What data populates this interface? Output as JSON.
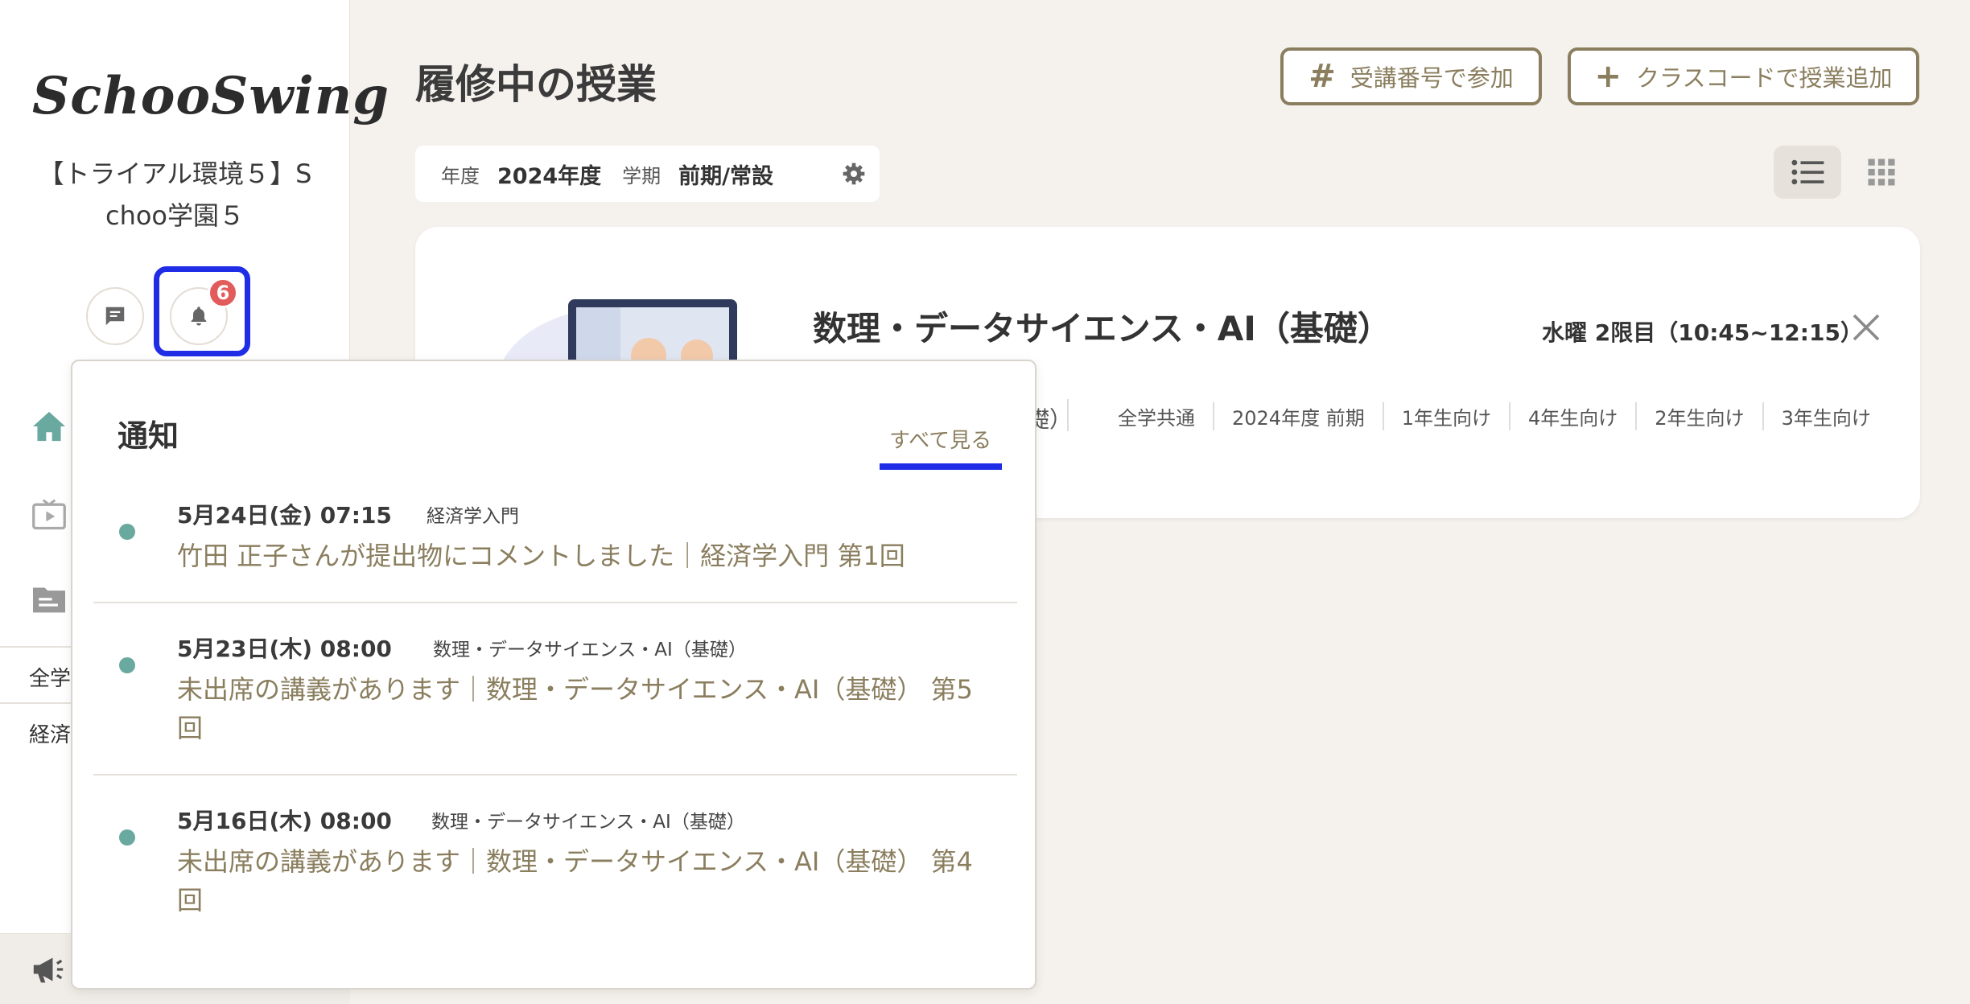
{
  "sidebar": {
    "logo": "SchooSwing",
    "school_name_line1": "【トライアル環境５】S",
    "school_name_line2": "choo学園５",
    "notification_count": "6",
    "list_items": [
      "全学",
      "経済"
    ]
  },
  "header": {
    "title": "履修中の授業",
    "join_by_number_label": "受講番号で参加",
    "add_by_class_code_label": "クラスコードで授業追加"
  },
  "filter": {
    "year_label": "年度",
    "year_value": "2024年度",
    "term_label": "学期",
    "term_value": "前期/常設"
  },
  "course": {
    "title": "数理・データサイエンス・AI（基礎）",
    "time": "水曜 2限目（10:45~12:15）",
    "tag_fragment": "礎）",
    "tags": [
      "全学共通",
      "2024年度 前期",
      "1年生向け",
      "4年生向け",
      "2年生向け",
      "3年生向け"
    ]
  },
  "notifications": {
    "title": "通知",
    "see_all": "すべて見る",
    "items": [
      {
        "date": "5月24日(金) 07:15",
        "course": "経済学入門",
        "message": "竹田 正子さんが提出物にコメントしました｜経済学入門 第1回"
      },
      {
        "date": "5月23日(木) 08:00",
        "course": "数理・データサイエンス・AI（基礎）",
        "message": "未出席の講義があります｜数理・データサイエンス・AI（基礎） 第5回"
      },
      {
        "date": "5月16日(木) 08:00",
        "course": "数理・データサイエンス・AI（基礎）",
        "message": "未出席の講義があります｜数理・データサイエンス・AI（基礎） 第4回"
      }
    ]
  },
  "colors": {
    "accent": "#8a7e5e",
    "highlight": "#1f2de6",
    "badge": "#e25c5c",
    "unread_dot": "#6aa9a0",
    "nav_active": "#6aa9a0"
  }
}
